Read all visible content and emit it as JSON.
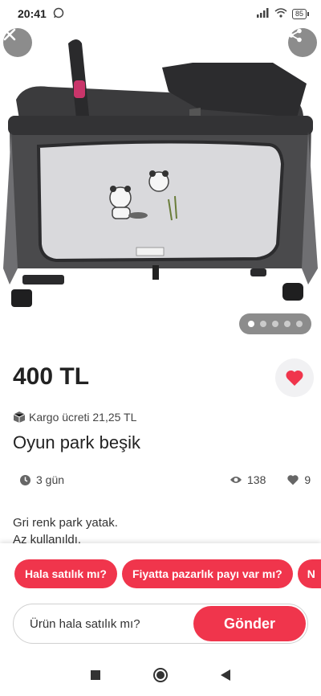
{
  "status_bar": {
    "time": "20:41",
    "battery": "85"
  },
  "gallery": {
    "image_count": 5,
    "active_index": 0
  },
  "listing": {
    "price": "400 TL",
    "cargo": "Kargo ücreti 21,25 TL",
    "title": "Oyun park beşik",
    "age": "3 gün",
    "views": "138",
    "likes": "9",
    "description_lines": [
      "Gri renk park yatak.",
      "Az kullanıldı."
    ]
  },
  "quick_replies": [
    "Hala satılık mı?",
    "Fiyatta pazarlık payı var mı?",
    "N"
  ],
  "message": {
    "value": "Ürün hala satılık mı?",
    "send_label": "Gönder"
  },
  "colors": {
    "accent": "#f0354c",
    "overlay": "#787878"
  }
}
